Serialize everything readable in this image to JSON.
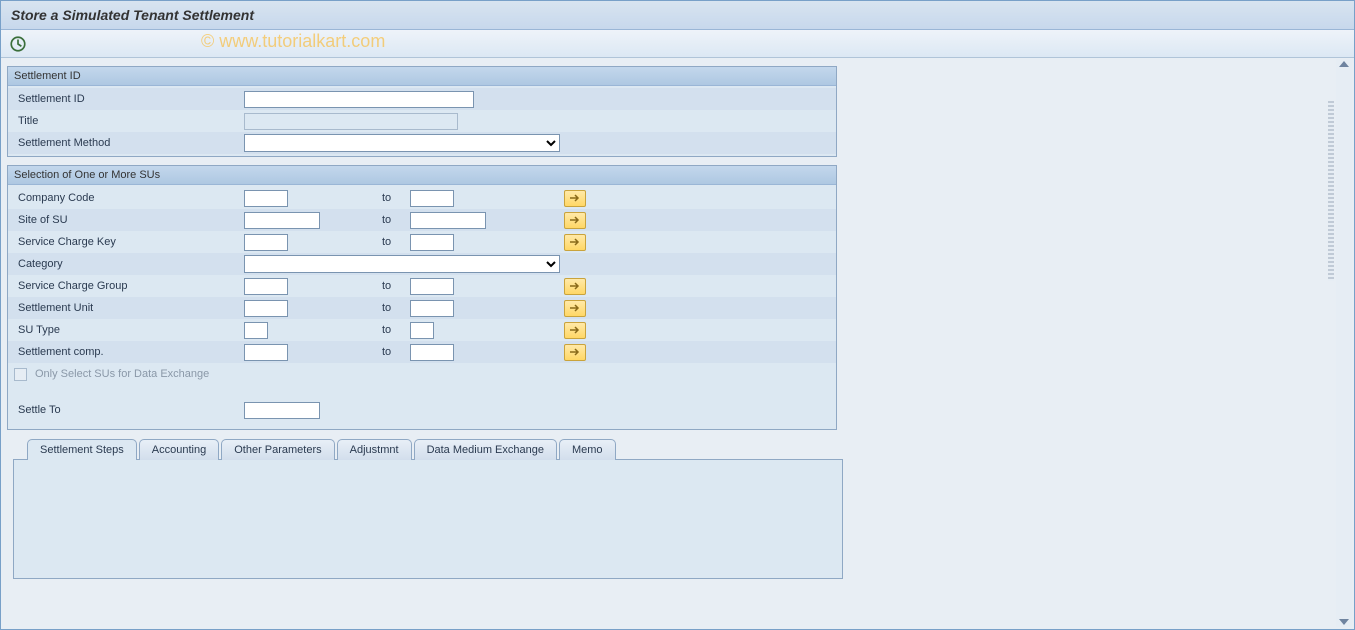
{
  "title": "Store a Simulated Tenant Settlement",
  "watermark": "© www.tutorialkart.com",
  "toolbar": {
    "execute_icon": "execute-icon"
  },
  "group1": {
    "header": "Settlement ID",
    "rows": {
      "settlement_id": "Settlement ID",
      "title": "Title",
      "method": "Settlement Method"
    }
  },
  "group2": {
    "header": "Selection of One or More SUs",
    "labels": {
      "company_code": "Company Code",
      "site_of_su": "Site of SU",
      "sc_key": "Service Charge Key",
      "category": "Category",
      "sc_group": "Service Charge Group",
      "settlement_unit": "Settlement Unit",
      "su_type": "SU Type",
      "settlement_comp": "Settlement comp.",
      "only_select": "Only Select SUs for Data Exchange",
      "settle_to": "Settle To",
      "to": "to"
    }
  },
  "tabs": [
    "Settlement Steps",
    "Accounting",
    "Other Parameters",
    "Adjustmnt",
    "Data Medium Exchange",
    "Memo"
  ]
}
